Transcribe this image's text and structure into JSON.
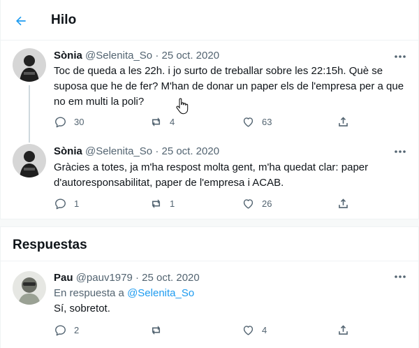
{
  "header": {
    "title": "Hilo"
  },
  "thread": [
    {
      "name": "Sònia",
      "handle": "@Selenita_So",
      "sep": "·",
      "date": "25 oct. 2020",
      "text": "Toc de queda a les 22h. i jo surto de treballar sobre les 22:15h. Què se suposa que he de fer? M'han de donar un paper els de l'empresa per a que no em multi la poli?",
      "replies": "30",
      "retweets": "4",
      "likes": "63"
    },
    {
      "name": "Sònia",
      "handle": "@Selenita_So",
      "sep": "·",
      "date": "25 oct. 2020",
      "text": "Gràcies a totes, ja m'ha respost molta gent, m'ha quedat clar: paper d'autoresponsabilitat, paper de l'empresa i ACAB.",
      "replies": "1",
      "retweets": "1",
      "likes": "26"
    }
  ],
  "section": {
    "title": "Respuestas"
  },
  "reply": {
    "name": "Pau",
    "handle": "@pauv1979",
    "sep": "·",
    "date": "25 oct. 2020",
    "in_reply_prefix": "En respuesta a",
    "in_reply_mention": "@Selenita_So",
    "text": "Sí, sobretot.",
    "replies": "2",
    "retweets": "",
    "likes": "4"
  },
  "colors": {
    "accent": "#1d9bf0",
    "text": "#0f1419",
    "muted": "#536471",
    "border": "#eff3f4"
  }
}
